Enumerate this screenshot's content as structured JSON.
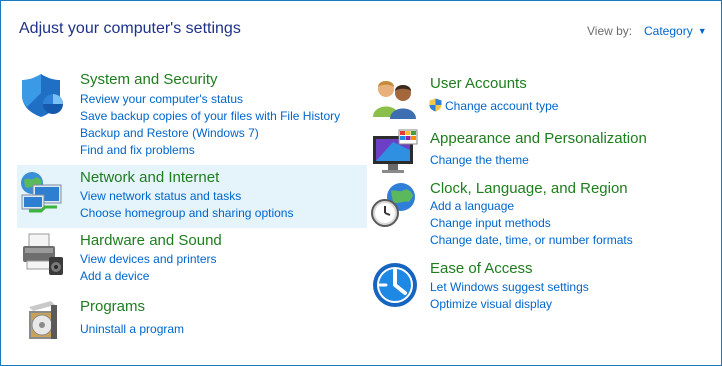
{
  "header": {
    "title": "Adjust your computer's settings",
    "view_by_label": "View by:",
    "view_by_value": "Category"
  },
  "categories": [
    {
      "name": "System and Security",
      "icon": "shield-icon",
      "links": [
        "Review your computer's status",
        "Save backup copies of your files with File History",
        "Backup and Restore (Windows 7)",
        "Find and fix problems"
      ]
    },
    {
      "name": "Network and Internet",
      "icon": "network-globe-icon",
      "links": [
        "View network status and tasks",
        "Choose homegroup and sharing options"
      ]
    },
    {
      "name": "Hardware and Sound",
      "icon": "printer-icon",
      "links": [
        "View devices and printers",
        "Add a device"
      ]
    },
    {
      "name": "Programs",
      "icon": "programs-disc-icon",
      "links": [
        "Uninstall a program"
      ]
    },
    {
      "name": "User Accounts",
      "icon": "users-icon",
      "links": [
        "Change account type"
      ]
    },
    {
      "name": "Appearance and Personalization",
      "icon": "monitor-palette-icon",
      "links": [
        "Change the theme"
      ]
    },
    {
      "name": "Clock, Language, and Region",
      "icon": "clock-globe-icon",
      "links": [
        "Add a language",
        "Change input methods",
        "Change date, time, or number formats"
      ]
    },
    {
      "name": "Ease of Access",
      "icon": "ease-of-access-icon",
      "links": [
        "Let Windows suggest settings",
        "Optimize visual display"
      ]
    }
  ],
  "colors": {
    "heading_green": "#1e7d1e",
    "link_blue": "#0066cc",
    "title_blue": "#1e3287",
    "hover_bg": "#e5f3fb"
  }
}
